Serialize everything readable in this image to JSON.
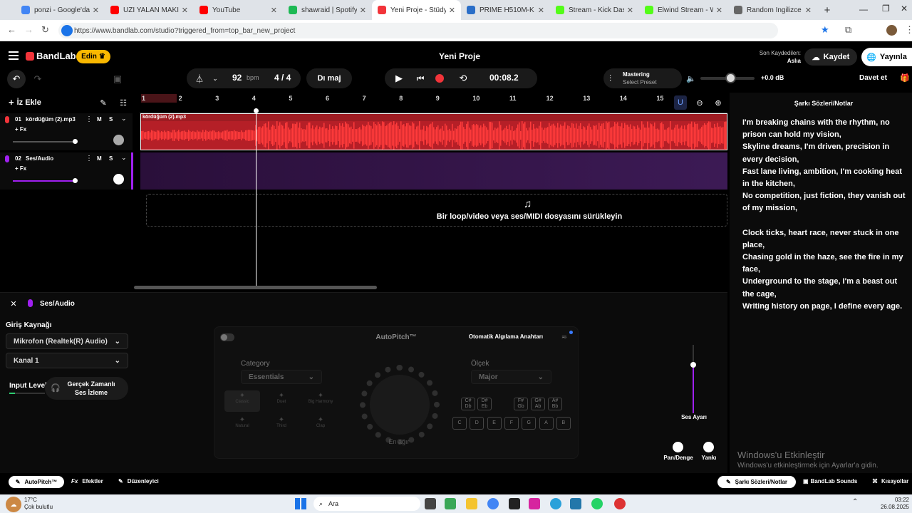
{
  "browser": {
    "tabs": [
      {
        "label": "ponzi - Google'da Ara",
        "color": "#4285f4"
      },
      {
        "label": "UZİ YALAN MAKİNESİ",
        "color": "#ff0000"
      },
      {
        "label": "YouTube",
        "color": "#ff0000"
      },
      {
        "label": "shawraid | Spotify",
        "color": "#1db954"
      },
      {
        "label": "Yeni Proje - Stüdyo",
        "color": "#f2343a"
      },
      {
        "label": "PRIME H510M-K | Ası",
        "color": "#2a6ec8"
      },
      {
        "label": "Stream - Kick Dashbo",
        "color": "#53fc18"
      },
      {
        "label": "Elwind Stream - Wat",
        "color": "#53fc18"
      },
      {
        "label": "Random İngilizce rap",
        "color": "#666666"
      }
    ],
    "url": "https://www.bandlab.com/studio?triggered_from=top_bar_new_project"
  },
  "header": {
    "logo": "BandLab",
    "edit_badge": "Edin",
    "project_title": "Yeni Proje",
    "last_saved_label": "Son Kaydedilen:",
    "last_saved_user": "Aslıa",
    "save_label": "Kaydet",
    "publish_label": "Yayınla"
  },
  "toolbar": {
    "bpm_value": "92",
    "bpm_unit": "bpm",
    "time_signature": "4 / 4",
    "key_label": "Dı maj",
    "time_display": "00:08.2",
    "mastering_title": "Mastering",
    "mastering_sub": "Select Preset",
    "volume_db": "+0.0 dB",
    "invite_label": "Davet et"
  },
  "tracks_header": {
    "add_label": "İz Ekle"
  },
  "tracks": [
    {
      "num": "01",
      "name": "kördüğüm (2).mp3",
      "fx": "+ Fx",
      "m": "M",
      "s": "S"
    },
    {
      "num": "02",
      "name": "Ses/Audio",
      "fx": "+ Fx",
      "m": "M",
      "s": "S"
    }
  ],
  "ruler": [
    "1",
    "2",
    "3",
    "4",
    "5",
    "6",
    "7",
    "8",
    "9",
    "10",
    "11",
    "12",
    "13",
    "14",
    "15"
  ],
  "clip_label": "kördüğüm (2).mp3",
  "drop_zone_text": "Bir loop/video veya ses/MIDI dosyasını sürükleyin",
  "lyrics": {
    "title": "Şarkı Sözleri/Notlar",
    "lines": [
      "I'm breaking chains with the rhythm, no",
      "prison can hold my vision,",
      "Skyline dreams, I'm driven, precision in",
      "every decision,",
      "Fast lane living, ambition, I'm cooking heat",
      "in the kitchen,",
      "No competition, just fiction, they vanish out",
      "of my mission,",
      "",
      "Clock ticks, heart race, never stuck in one",
      "place,",
      "Chasing gold in the haze, see the fire in my",
      "face,",
      "Underground to the stage, I'm a beast out",
      "the cage,",
      "Writing history on page, I define every age."
    ]
  },
  "bottom_panel": {
    "track_name": "Ses/Audio",
    "input_source_label": "Giriş Kaynağı",
    "input_device": "Mikrofon (Realtek(R) Audio)",
    "channel": "Kanal 1",
    "input_level_label": "Input Level",
    "monitor_label_1": "Gerçek Zamanlı",
    "monitor_label_2": "Ses İzleme",
    "autopitch_title": "AutoPitch™",
    "auto_detect_label": "Otomatik Algılama Anahtarı",
    "category_label": "Category",
    "category_value": "Essentials",
    "scale_label": "Ölçek",
    "scale_value": "Major",
    "presets": [
      "Classic",
      "Duet",
      "Big Harmony",
      "Natural",
      "Third",
      "Clap"
    ],
    "knob_label": "En ağır",
    "scale_keys_top": [
      "C#\nDb",
      "D#\nEb",
      "F#\nGb",
      "G#\nAb",
      "A#\nBb"
    ],
    "scale_keys_bottom": [
      "C",
      "D",
      "E",
      "F",
      "G",
      "A",
      "B"
    ],
    "volume_label": "Ses Ayarı",
    "pan_label": "Pan/Denge",
    "reverb_label": "Yankı"
  },
  "bottom_bar": {
    "autopitch": "AutoPitch™",
    "effects": "Efektler",
    "editor": "Düzenleyici",
    "lyrics": "Şarkı Sözleri/Notlar",
    "sounds": "BandLab Sounds",
    "shortcuts": "Kısayollar"
  },
  "watermark": {
    "title": "Windows'u Etkinleştir",
    "sub": "Windows'u etkinleştirmek için Ayarlar'a gidin."
  },
  "taskbar": {
    "weather_temp": "17°C",
    "weather_desc": "Çok bulutlu",
    "search_label": "Ara",
    "time": "03:22",
    "date": "26.08.2025"
  },
  "colors": {
    "accent": "#f2343a",
    "purple": "#a020f0",
    "badge": "#f9b800"
  }
}
